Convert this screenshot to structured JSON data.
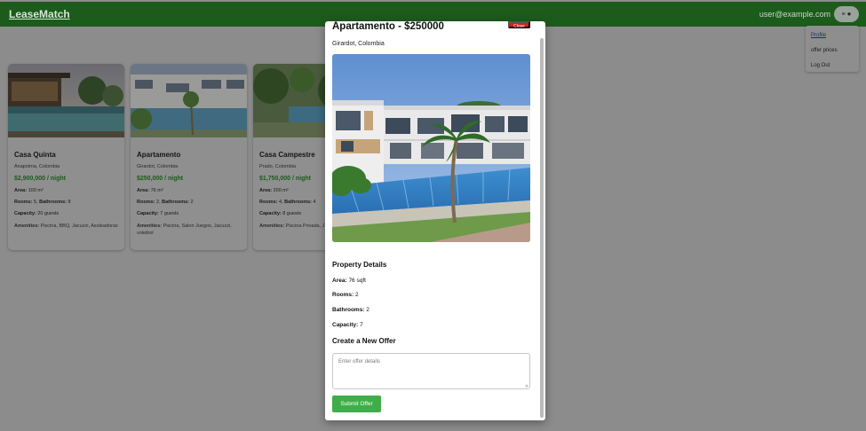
{
  "header": {
    "brand": "LeaseMatch",
    "user_email": "user@example.com",
    "menu_icon": "menu-icon",
    "avatar_icon": "person-icon"
  },
  "dropdown": {
    "items": [
      {
        "label": "Profile"
      },
      {
        "label": "offer prices"
      },
      {
        "label": "Log Out"
      }
    ]
  },
  "cards": [
    {
      "title": "Casa Quinta",
      "location": "Anapoima, Colombia",
      "price": "$2,900,000 / night",
      "area_label": "Area:",
      "area": "100 m²",
      "rooms_label": "Rooms:",
      "rooms": "5,",
      "baths_label": "Bathrooms:",
      "baths": "8",
      "capacity_label": "Capacity:",
      "capacity": "20 guests",
      "amenities_label": "Amenities:",
      "amenities": "Piscina, BBQ, Jacuzzi, Asoleadoras"
    },
    {
      "title": "Apartamento",
      "location": "Girardot, Colombia",
      "price": "$250,000 / night",
      "area_label": "Area:",
      "area": "76 m²",
      "rooms_label": "Rooms:",
      "rooms": "2,",
      "baths_label": "Bathrooms:",
      "baths": "2",
      "capacity_label": "Capacity:",
      "capacity": "7 guests",
      "amenities_label": "Amenities:",
      "amenities": "Piscina, Salon Juegos, Jacuzzi, voleibol"
    },
    {
      "title": "Casa Campestre",
      "location": "Prado, Colombia",
      "price": "$1,750,000 / night",
      "area_label": "Area:",
      "area": "200 m²",
      "rooms_label": "Rooms:",
      "rooms": "4,",
      "baths_label": "Bathrooms:",
      "baths": "4",
      "capacity_label": "Capacity:",
      "capacity": "8 guests",
      "amenities_label": "Amenities:",
      "amenities": "Piscina Privada, J BBQ"
    }
  ],
  "modal": {
    "title": "Apartamento - $250000",
    "close_label": "Close",
    "location": "Girardot, Colombia",
    "details_heading": "Property Details",
    "area_label": "Area:",
    "area": "76 sqft",
    "rooms_label": "Rooms:",
    "rooms": "2",
    "bathrooms_label": "Bathrooms:",
    "bathrooms": "2",
    "capacity_label": "Capacity:",
    "capacity": "7",
    "offer_heading": "Create a New Offer",
    "offer_placeholder": "Enter offer details",
    "submit_label": "Submit Offer"
  }
}
